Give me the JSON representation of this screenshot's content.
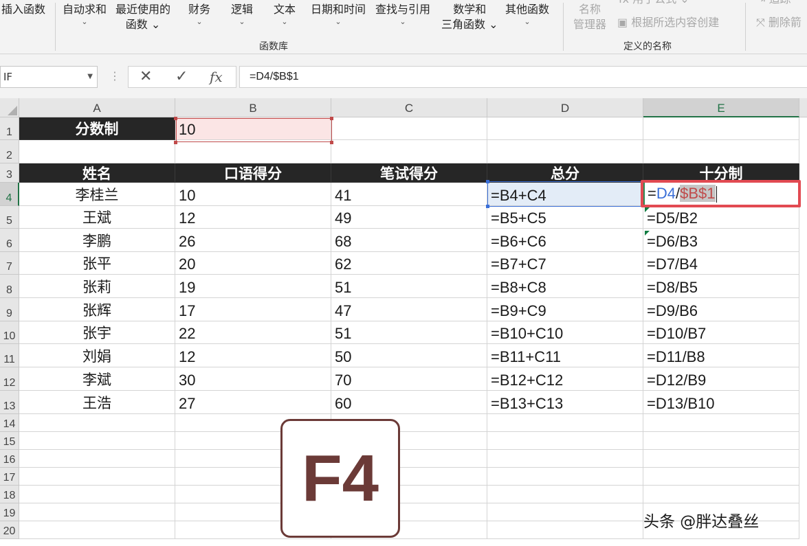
{
  "ribbon": {
    "buttons": [
      {
        "id": "insert",
        "l1": "插入函数",
        "l2": ""
      },
      {
        "id": "autosum",
        "l1": "自动求和",
        "l2": "⌄"
      },
      {
        "id": "recent",
        "l1": "最近使用的",
        "l2": "函数 ⌄"
      },
      {
        "id": "financial",
        "l1": "财务",
        "l2": "⌄"
      },
      {
        "id": "logical",
        "l1": "逻辑",
        "l2": "⌄"
      },
      {
        "id": "text",
        "l1": "文本",
        "l2": "⌄"
      },
      {
        "id": "datetime",
        "l1": "日期和时间",
        "l2": "⌄"
      },
      {
        "id": "lookup",
        "l1": "查找与引用",
        "l2": "⌄"
      },
      {
        "id": "mathtrig",
        "l1": "数学和",
        "l2": "三角函数 ⌄"
      },
      {
        "id": "more",
        "l1": "其他函数",
        "l2": "⌄"
      }
    ],
    "name_manager": {
      "l1": "名称",
      "l2": "管理器"
    },
    "define_name": "fx 用于公式 ⌄",
    "create_from_selection": "根据所选内容创建",
    "trace": "追踪",
    "remove_arrows": "删除箭",
    "group_function_library": "函数库",
    "group_defined_names": "定义的名称"
  },
  "formula_bar": {
    "name_box": "IF",
    "cancel": "✕",
    "enter": "✓",
    "fx": "fx",
    "content": "=D4/$B$1"
  },
  "columns": [
    "A",
    "B",
    "C",
    "D",
    "E"
  ],
  "rows": [
    "1",
    "2",
    "3",
    "4",
    "5",
    "6",
    "7",
    "8",
    "9",
    "10",
    "11",
    "12",
    "13",
    "14",
    "15",
    "16",
    "17",
    "18",
    "19",
    "20"
  ],
  "sheet": {
    "A1": "分数制",
    "B1": "10",
    "headers": [
      "姓名",
      "口语得分",
      "笔试得分",
      "总分",
      "十分制"
    ],
    "data": [
      [
        "李桂兰",
        "10",
        "41",
        "=B4+C4",
        ""
      ],
      [
        "王斌",
        "12",
        "49",
        "=B5+C5",
        "=D5/B2"
      ],
      [
        "李鹏",
        "26",
        "68",
        "=B6+C6",
        "=D6/B3"
      ],
      [
        "张平",
        "20",
        "62",
        "=B7+C7",
        "=D7/B4"
      ],
      [
        "张莉",
        "19",
        "51",
        "=B8+C8",
        "=D8/B5"
      ],
      [
        "张辉",
        "17",
        "47",
        "=B9+C9",
        "=D9/B6"
      ],
      [
        "张宇",
        "22",
        "51",
        "=B10+C10",
        "=D10/B7"
      ],
      [
        "刘娟",
        "12",
        "50",
        "=B11+C11",
        "=D11/B8"
      ],
      [
        "李斌",
        "30",
        "70",
        "=B12+C12",
        "=D12/B9"
      ],
      [
        "王浩",
        "27",
        "60",
        "=B13+C13",
        "=D13/B10"
      ]
    ],
    "edit": {
      "eq": "=",
      "ref1": "D4",
      "slash": "/",
      "ref2": "$B$1"
    }
  },
  "key_badge": "F4",
  "watermark": "头条 @胖达叠丝"
}
